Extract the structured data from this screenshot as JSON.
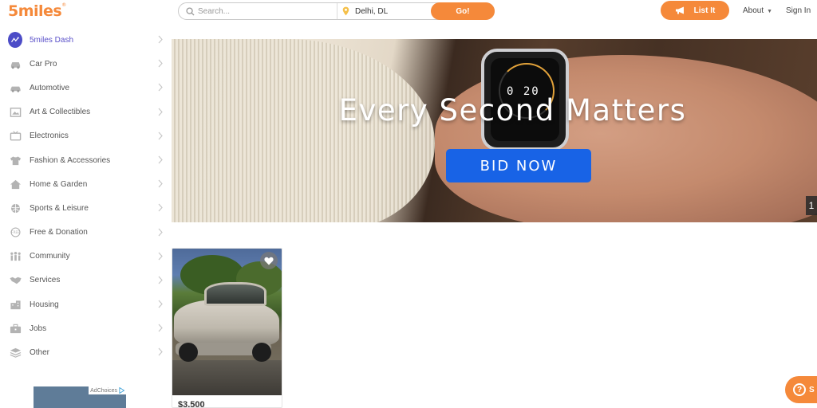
{
  "header": {
    "logo_text": "5miles",
    "logo_mark": "®",
    "search_placeholder": "Search...",
    "location": "Delhi, DL",
    "go_label": "Go!",
    "list_it_label": "List It",
    "about_label": "About",
    "about_caret": "▼",
    "signin_label": "Sign In"
  },
  "sidebar": {
    "items": [
      {
        "label": "5miles Dash",
        "icon": "dash-icon"
      },
      {
        "label": "Car Pro",
        "icon": "car-icon"
      },
      {
        "label": "Automotive",
        "icon": "automotive-icon"
      },
      {
        "label": "Art & Collectibles",
        "icon": "art-icon"
      },
      {
        "label": "Electronics",
        "icon": "tv-icon"
      },
      {
        "label": "Fashion & Accessories",
        "icon": "shirt-icon"
      },
      {
        "label": "Home & Garden",
        "icon": "home-icon"
      },
      {
        "label": "Sports & Leisure",
        "icon": "ball-icon"
      },
      {
        "label": "Free & Donation",
        "icon": "free-icon"
      },
      {
        "label": "Community",
        "icon": "community-icon"
      },
      {
        "label": "Services",
        "icon": "handshake-icon"
      },
      {
        "label": "Housing",
        "icon": "building-icon"
      },
      {
        "label": "Jobs",
        "icon": "briefcase-icon"
      },
      {
        "label": "Other",
        "icon": "layers-icon"
      }
    ],
    "ad_choices": "AdChoices"
  },
  "banner": {
    "title": "Every Second Matters",
    "button_label": "BID NOW",
    "slide_indicator": "1",
    "watch_digits": "0 20"
  },
  "listing": {
    "price": "$3,500"
  },
  "help": {
    "symbol": "?",
    "label": "S"
  },
  "colors": {
    "brand_orange": "#f5893a",
    "bid_blue": "#1863e6",
    "active_purple": "#5a50c9"
  }
}
